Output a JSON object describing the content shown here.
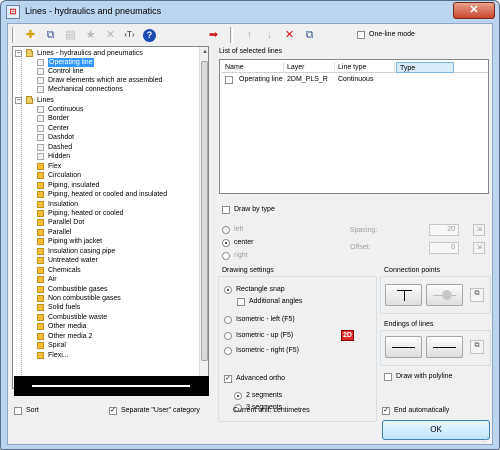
{
  "window": {
    "title": "Lines - hydraulics and pneumatics",
    "close_label": "✕"
  },
  "toolbar": {
    "buttons": [
      {
        "name": "new-icon",
        "glyph": "✚"
      },
      {
        "name": "copy-icon",
        "glyph": "⧉"
      },
      {
        "name": "grid-icon",
        "glyph": "▤"
      },
      {
        "name": "star-icon",
        "glyph": "★"
      },
      {
        "name": "delete-icon",
        "glyph": "✕"
      },
      {
        "name": "rename-icon",
        "glyph": "‹T›"
      },
      {
        "name": "help-icon",
        "glyph": "?"
      }
    ],
    "list_buttons": [
      {
        "name": "add-arrow-icon",
        "glyph": "➡"
      },
      {
        "name": "move-up-icon",
        "glyph": "↑"
      },
      {
        "name": "move-down-icon",
        "glyph": "↓"
      },
      {
        "name": "remove-icon",
        "glyph": "✕"
      },
      {
        "name": "copy-list-icon",
        "glyph": "⧉"
      }
    ],
    "one_line_mode_label": "One-line mode",
    "one_line_mode_checked": false
  },
  "tree": {
    "category1": "Lines - hydraulics and pneumatics",
    "category1_items": [
      "Operating line",
      "Control line",
      "Draw elements which are assembled",
      "Mechanical connections"
    ],
    "category2": "Lines",
    "category2_items": [
      {
        "label": "Continuous",
        "color": "grey"
      },
      {
        "label": "Border",
        "color": "grey"
      },
      {
        "label": "Center",
        "color": "grey"
      },
      {
        "label": "Dashdot",
        "color": "grey"
      },
      {
        "label": "Dashed",
        "color": "grey"
      },
      {
        "label": "Hidden",
        "color": "grey"
      },
      {
        "label": "Flex",
        "color": "yellow"
      },
      {
        "label": "Circulation",
        "color": "yellow"
      },
      {
        "label": "Piping, insulated",
        "color": "yellow"
      },
      {
        "label": "Piping, heated or cooled and insulated",
        "color": "yellow"
      },
      {
        "label": "Insulation",
        "color": "yellow"
      },
      {
        "label": "Piping, heated or cooled",
        "color": "yellow"
      },
      {
        "label": "Parallel Dot",
        "color": "yellow"
      },
      {
        "label": "Parallel",
        "color": "yellow"
      },
      {
        "label": "Piping with jacket",
        "color": "yellow"
      },
      {
        "label": "Insulation casing pipe",
        "color": "yellow"
      },
      {
        "label": "Untreated water",
        "color": "yellow"
      },
      {
        "label": "Chemicals",
        "color": "yellow"
      },
      {
        "label": "Air",
        "color": "yellow"
      },
      {
        "label": "Combustible gases",
        "color": "yellow"
      },
      {
        "label": "Non combustible gases",
        "color": "yellow"
      },
      {
        "label": "Solid fuels",
        "color": "yellow"
      },
      {
        "label": "Combustible waste",
        "color": "yellow"
      },
      {
        "label": "Other media",
        "color": "yellow"
      },
      {
        "label": "Other media 2",
        "color": "yellow"
      },
      {
        "label": "Spiral",
        "color": "yellow"
      },
      {
        "label": "Flexi...",
        "color": "yellow"
      }
    ],
    "selected_item": "Operating line"
  },
  "selected_list": {
    "label": "List of selected lines",
    "columns": [
      "Name",
      "Layer",
      "Line type",
      "Type"
    ],
    "rows": [
      {
        "name": "Operating line",
        "layer": "2DM_PLS_R",
        "line_type": "Continuous",
        "type": ""
      }
    ]
  },
  "draw_by_type": {
    "label": "Draw by type",
    "checked": false,
    "left_label": "left",
    "center_label": "center",
    "right_label": "right",
    "selected": "center",
    "spacing_label": "Spacing:",
    "spacing_value": "20",
    "offset_label": "Offset:",
    "offset_value": "0"
  },
  "drawing_settings": {
    "label": "Drawing settings",
    "rectangle_snap": "Rectangle snap",
    "additional_angles": "Additional angles",
    "isometric_left": "Isometric - left (F5)",
    "isometric_up": "Isometric - up (F5)",
    "isometric_right": "Isometric - right (F5)",
    "badge_2d": "2D",
    "advanced_ortho": "Advanced ortho",
    "advanced_ortho_checked": true,
    "segments_2": "2 segments",
    "segments_3": "3 segments",
    "segments_selected": "2 segments"
  },
  "connection_points": {
    "label": "Connection points"
  },
  "endings": {
    "label": "Endings of lines"
  },
  "draw_with_polyline": {
    "label": "Draw with polyline",
    "checked": false
  },
  "footer": {
    "sort_label": "Sort",
    "sort_checked": false,
    "separate_label": "Separate \"User\" category",
    "separate_checked": true,
    "current_unit": "Current unit: centimetres",
    "end_auto_label": "End automatically",
    "end_auto_checked": true,
    "ok_label": "OK"
  },
  "colors": {
    "window_frame": "#bcd5ee",
    "selection": "#3399ff",
    "line_icon_yellow": "#f5bf35",
    "close_red": "#c8462c"
  }
}
